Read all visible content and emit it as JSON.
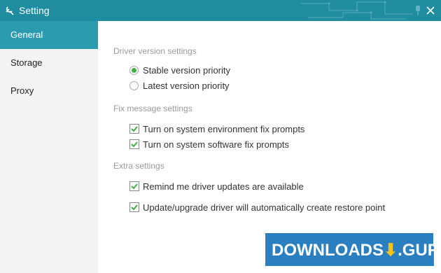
{
  "window": {
    "title": "Setting"
  },
  "sidebar": {
    "items": [
      {
        "label": "General"
      },
      {
        "label": "Storage"
      },
      {
        "label": "Proxy"
      }
    ],
    "active": "General"
  },
  "driver_version": {
    "title": "Driver version settings",
    "options": [
      {
        "label": "Stable version priority",
        "selected": true
      },
      {
        "label": "Latest version priority",
        "selected": false
      }
    ]
  },
  "fix_message": {
    "title": "Fix message settings",
    "options": [
      {
        "label": "Turn on system environment fix prompts",
        "checked": true
      },
      {
        "label": "Turn on system software fix prompts",
        "checked": true
      }
    ]
  },
  "extra": {
    "title": "Extra settings",
    "options": [
      {
        "label": "Remind me driver updates are available",
        "checked": true
      },
      {
        "label": "Update/upgrade driver will automatically create restore point",
        "checked": true
      }
    ]
  },
  "watermark": {
    "text_left": "DOWNLOADS",
    "text_right": ".GURU"
  },
  "colors": {
    "titlebar": "#1f8ca0",
    "sidebar_active": "#2b9bb0",
    "check_green": "#3cb046",
    "watermark_blue": "#2a7fc0"
  }
}
